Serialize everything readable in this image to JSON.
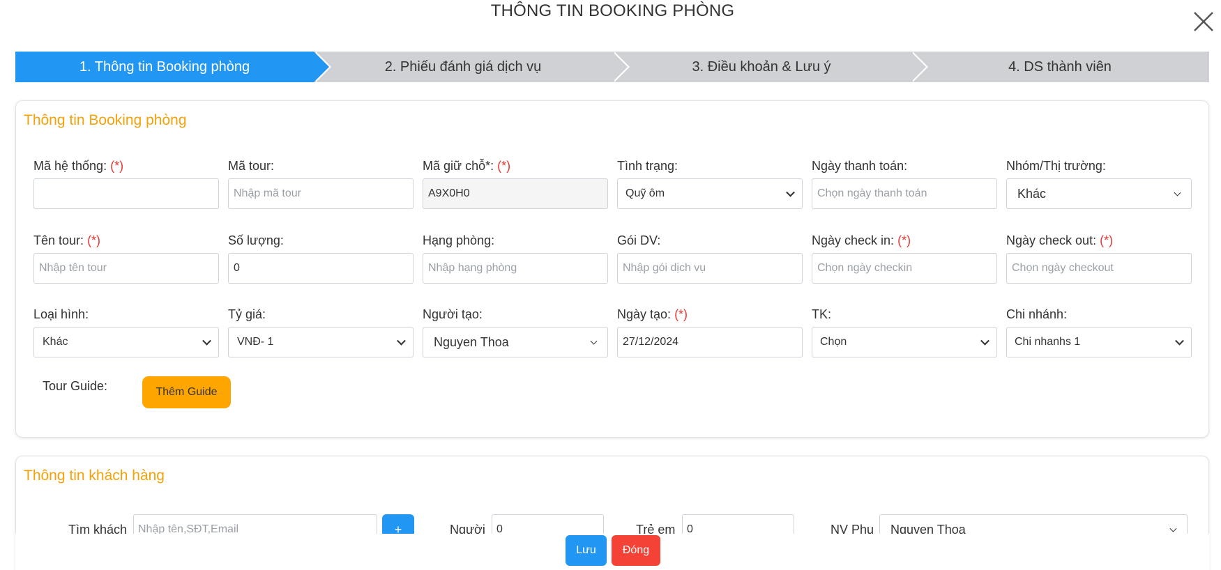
{
  "modal": {
    "title": "THÔNG TIN BOOKING PHÒNG"
  },
  "steps": [
    {
      "label": "1. Thông tin Booking phòng",
      "active": true
    },
    {
      "label": "2. Phiếu đánh giá dịch vụ",
      "active": false
    },
    {
      "label": "3. Điều khoản & Lưu ý",
      "active": false
    },
    {
      "label": "4. DS thành viên",
      "active": false
    }
  ],
  "booking": {
    "title": "Thông tin Booking phòng",
    "required_mark": "(*)",
    "fields": {
      "ma_he_thong": {
        "label": "Mã hệ thống:",
        "value": ""
      },
      "ma_tour": {
        "label": "Mã tour:",
        "placeholder": "Nhập mã tour"
      },
      "ma_giu_cho": {
        "label": "Mã giữ chỗ*:",
        "value": "A9X0H0"
      },
      "tinh_trang": {
        "label": "Tình trạng:",
        "value": "Quỹ ôm"
      },
      "ngay_thanh_toan": {
        "label": "Ngày thanh toán:",
        "placeholder": "Chọn ngày thanh toán"
      },
      "nhom_thi_truong": {
        "label": "Nhóm/Thị trường:",
        "value": "Khác"
      },
      "ten_tour": {
        "label": "Tên tour:",
        "placeholder": "Nhập tên tour"
      },
      "so_luong": {
        "label": "Số lượng:",
        "value": "0"
      },
      "hang_phong": {
        "label": "Hạng phòng:",
        "placeholder": "Nhập hạng phòng"
      },
      "goi_dv": {
        "label": "Gói DV:",
        "placeholder": "Nhập gói dịch vụ"
      },
      "ngay_check_in": {
        "label": "Ngày check in:",
        "placeholder": "Chọn ngày checkin"
      },
      "ngay_check_out": {
        "label": "Ngày check out:",
        "placeholder": "Chọn ngày checkout"
      },
      "loai_hinh": {
        "label": "Loại hình:",
        "value": "Khác"
      },
      "ty_gia": {
        "label": "Tỷ giá:",
        "value": "VNĐ- 1"
      },
      "nguoi_tao": {
        "label": "Người tạo:",
        "value": "Nguyen Thoa"
      },
      "ngay_tao": {
        "label": "Ngày tạo:",
        "value": "27/12/2024"
      },
      "tk": {
        "label": "TK:",
        "value": "Chọn"
      },
      "chi_nhanh": {
        "label": "Chi nhánh:",
        "value": "Chi nhanhs 1"
      }
    },
    "tour_guide_label": "Tour Guide:",
    "add_guide_button": "Thêm Guide"
  },
  "customer": {
    "title": "Thông tin khách hàng",
    "search_label": "Tìm khách",
    "search_placeholder": "Nhập tên,SĐT,Email",
    "add_button": "+",
    "adult_label": "Người",
    "adult_value": "0",
    "child_label": "Trẻ em",
    "child_value": "0",
    "staff_label": "NV Phụ",
    "staff_value": "Nguyen Thoa"
  },
  "footer": {
    "save_label": "Lưu",
    "close_label": "Đóng"
  },
  "colors": {
    "primary": "#2196f3",
    "accent": "#f5a20a",
    "danger": "#f44336",
    "guide_button": "#ffa500",
    "step_inactive": "#cfd1d4"
  }
}
